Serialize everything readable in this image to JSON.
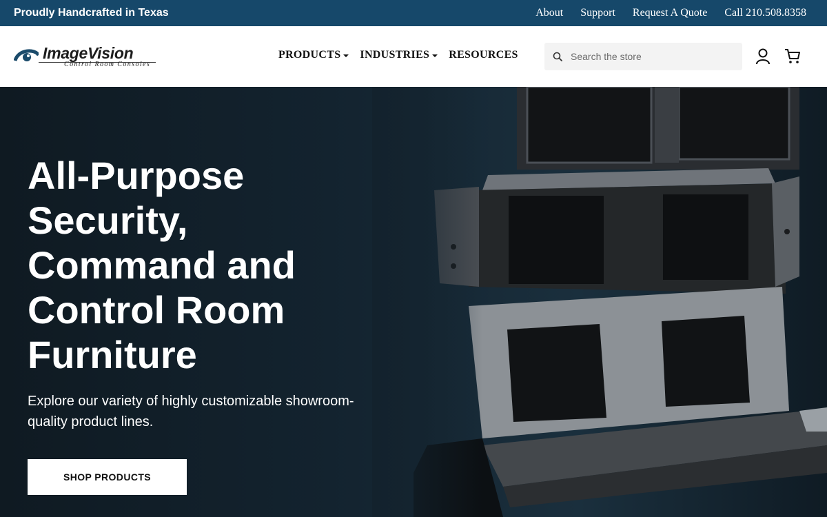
{
  "announcement": {
    "tagline": "Proudly Handcrafted in Texas",
    "links": [
      "About",
      "Support",
      "Request A Quote",
      "Call 210.508.8358"
    ]
  },
  "header": {
    "logo": {
      "brand": "ImageVision",
      "subtitle": "Control Room Consoles"
    },
    "nav": [
      {
        "label": "PRODUCTS",
        "has_dropdown": true
      },
      {
        "label": "INDUSTRIES",
        "has_dropdown": true
      },
      {
        "label": "RESOURCES",
        "has_dropdown": false
      }
    ],
    "search": {
      "placeholder": "Search the store",
      "value": ""
    },
    "icons": [
      "search-icon",
      "account-icon",
      "cart-icon"
    ]
  },
  "hero": {
    "title": "All-Purpose Security, Command and Control Room Furniture",
    "description": "Explore our variety of highly customizable showroom-quality product lines.",
    "cta_label": "SHOP PRODUCTS"
  },
  "colors": {
    "announcement_bg": "#16486a",
    "hero_bg": "#13232f",
    "cta_bg": "#ffffff"
  }
}
